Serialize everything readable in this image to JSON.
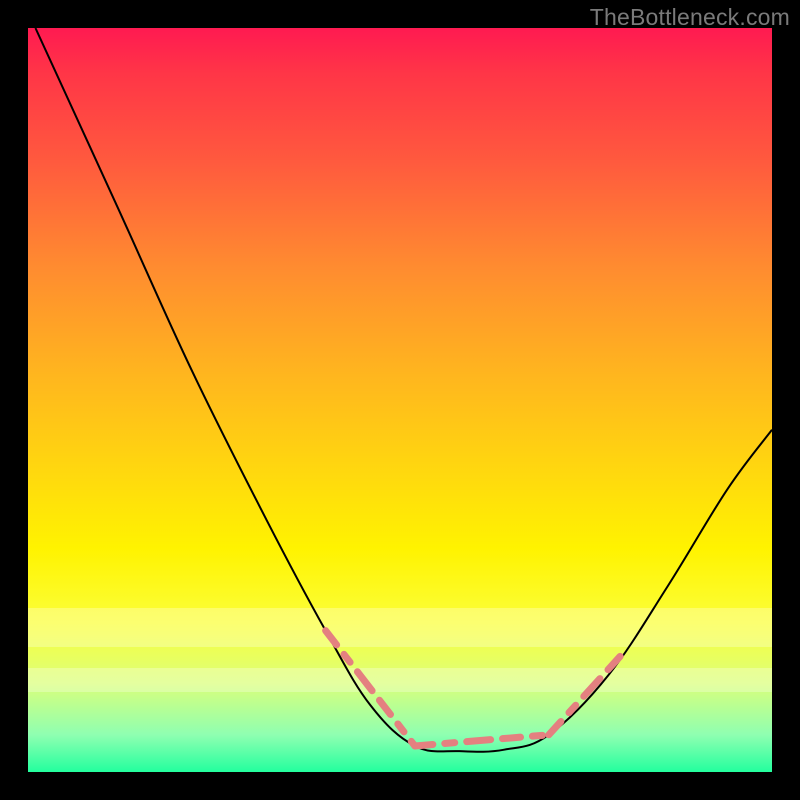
{
  "watermark": {
    "text": "TheBottleneck.com"
  },
  "bands": [
    {
      "top_pct": 78.0,
      "height_pct": 5.2
    },
    {
      "top_pct": 86.0,
      "height_pct": 3.2
    }
  ],
  "chart_data": {
    "type": "line",
    "title": "",
    "xlabel": "",
    "ylabel": "",
    "xlim": [
      0,
      100
    ],
    "ylim": [
      0,
      100
    ],
    "grid": false,
    "legend": false,
    "annotations": [],
    "curve": [
      {
        "x": 1,
        "y": 100
      },
      {
        "x": 12,
        "y": 76
      },
      {
        "x": 22,
        "y": 54
      },
      {
        "x": 32,
        "y": 34
      },
      {
        "x": 40,
        "y": 19
      },
      {
        "x": 46,
        "y": 9
      },
      {
        "x": 52,
        "y": 3.5
      },
      {
        "x": 58,
        "y": 2.8
      },
      {
        "x": 64,
        "y": 3.0
      },
      {
        "x": 70,
        "y": 5.0
      },
      {
        "x": 78,
        "y": 13
      },
      {
        "x": 86,
        "y": 25
      },
      {
        "x": 94,
        "y": 38
      },
      {
        "x": 100,
        "y": 46
      }
    ],
    "dash_segments": [
      {
        "x0": 40.0,
        "y0": 19.0,
        "x1": 52.0,
        "y1": 3.5
      },
      {
        "x0": 52.0,
        "y0": 3.5,
        "x1": 70.0,
        "y1": 5.0
      },
      {
        "x0": 70.0,
        "y0": 5.0,
        "x1": 80.0,
        "y1": 16.0
      }
    ],
    "dash_style": {
      "color": "#e48080",
      "width": 7,
      "pattern": "18 12 10 12 24 12"
    },
    "curve_style": {
      "color": "#000000",
      "width": 2
    }
  }
}
